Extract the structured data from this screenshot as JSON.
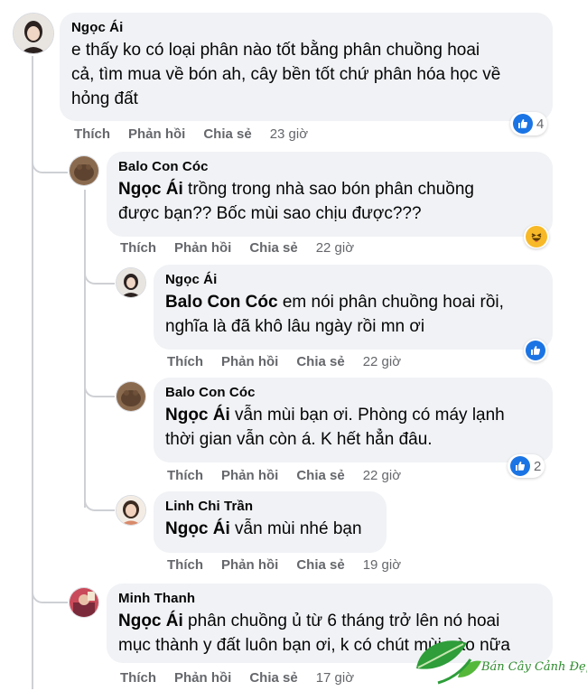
{
  "comments": [
    {
      "author": "Ngọc Ái",
      "text": "e thấy ko có loại phân nào tốt bằng phân chuồng hoai cả, tìm mua về bón ah, cây bền tốt chứ phân hóa học về hỏng đất",
      "line1": "e thấy ko có loại phân nào tốt bằng phân chuồng hoai",
      "line2": "cả, tìm mua về bón ah, cây bền tốt chứ phân hóa học về",
      "line3": "hỏng đất",
      "like": "Thích",
      "reply": "Phản hồi",
      "share": "Chia sẻ",
      "time": "23 giờ",
      "reaction": "like-icon",
      "reaction_count": "4"
    },
    {
      "author": "Balo Con Cóc",
      "mention": "Ngọc Ái",
      "line1": " trồng trong nhà sao bón phân chuồng",
      "line2": "được bạn?? Bốc mùi sao chịu được???",
      "like": "Thích",
      "reply": "Phản hồi",
      "share": "Chia sẻ",
      "time": "22 giờ",
      "reaction": "haha-icon"
    },
    {
      "author": "Ngọc Ái",
      "mention": "Balo Con Cóc",
      "line1": " em nói phân chuồng hoai rồi,",
      "line2": "nghĩa là đã khô lâu ngày rồi mn ơi",
      "like": "Thích",
      "reply": "Phản hồi",
      "share": "Chia sẻ",
      "time": "22 giờ",
      "reaction": "like-icon"
    },
    {
      "author": "Balo Con Cóc",
      "mention": "Ngọc Ái",
      "line1": " vẫn mùi bạn ơi. Phòng có máy lạnh",
      "line2": "thời gian vẫn còn á. K hết hẳn đâu.",
      "like": "Thích",
      "reply": "Phản hồi",
      "share": "Chia sẻ",
      "time": "22 giờ",
      "reaction": "like-icon",
      "reaction_count": "2"
    },
    {
      "author": "Linh Chi Trần",
      "mention": "Ngọc Ái",
      "line1": " vẫn mùi nhé bạn",
      "like": "Thích",
      "reply": "Phản hồi",
      "share": "Chia sẻ",
      "time": "19 giờ"
    },
    {
      "author": "Minh Thanh",
      "mention": "Ngọc Ái",
      "line1": " phân chuồng ủ từ 6 tháng trở lên nó hoai",
      "line2": "mục thành y đất luôn bạn ơi, k có chút mùi nào nữa",
      "like": "Thích",
      "reply": "Phản hồi",
      "share": "Chia sẻ",
      "time": "17 giờ"
    }
  ],
  "watermark": {
    "text": "Bán Cây Cảnh Đẹp"
  },
  "colors": {
    "like_blue": "#1b74e4",
    "bubble": "#f0f2f5",
    "meta": "#65676b"
  }
}
